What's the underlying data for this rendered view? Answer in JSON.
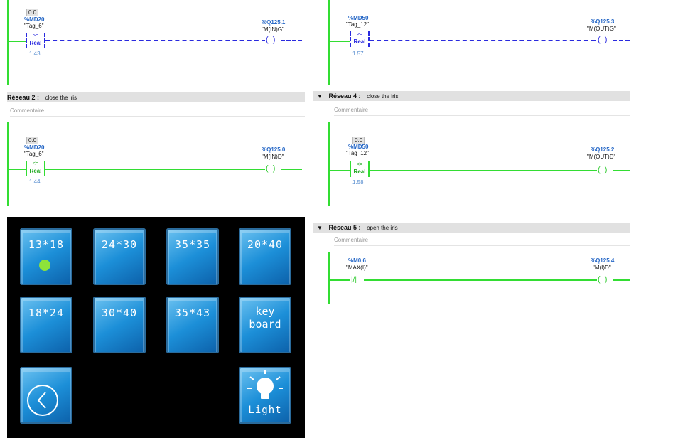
{
  "networks": {
    "n1_tail": {
      "value": "0.0",
      "address": "%MD20",
      "tag": "\"Tag_6\"",
      "op": ">=",
      "type": "Real",
      "operand": "1.43",
      "coil_address": "%Q125.1",
      "coil_tag": "\"M(IN)G\""
    },
    "n2": {
      "label": "Réseau 2 :",
      "title": "close the iris",
      "comment": "Commentaire",
      "value": "0.0",
      "address": "%MD20",
      "tag": "\"Tag_6\"",
      "op": "<=",
      "type": "Real",
      "operand": "1.44",
      "coil_address": "%Q125.0",
      "coil_tag": "\"M(IN)D\""
    },
    "n3_tail": {
      "value": "0.0",
      "address": "%MD50",
      "tag": "\"Tag_12\"",
      "op": ">=",
      "type": "Real",
      "operand": "1.57",
      "coil_address": "%Q125.3",
      "coil_tag": "\"M(OUT)G\""
    },
    "n4": {
      "label": "Réseau 4 :",
      "title": "close the iris",
      "comment": "Commentaire",
      "value": "0.0",
      "address": "%MD50",
      "tag": "\"Tag_12\"",
      "op": "<=",
      "type": "Real",
      "operand": "1.58",
      "coil_address": "%Q125.2",
      "coil_tag": "\"M(OUT)D\""
    },
    "n5": {
      "label": "Réseau 5 :",
      "title": "open the iris",
      "comment": "Commentaire",
      "contact_address": "%M0.6",
      "contact_tag": "\"MAX(I)\"",
      "coil_address": "%Q125.4",
      "coil_tag": "\"M(I)D\""
    }
  },
  "hmi": {
    "buttons_row1": [
      "13*18",
      "24*30",
      "35*35",
      "20*40"
    ],
    "buttons_row2": [
      "18*24",
      "30*40",
      "35*43"
    ],
    "keyboard_line1": "key",
    "keyboard_line2": "board",
    "light_label": "Light",
    "active_button": "13*18"
  },
  "colors": {
    "energized": "#33dd33",
    "unpowered": "#2a2adf",
    "hmi_button": "#1c8fd8",
    "indicator": "#8ee33a"
  }
}
